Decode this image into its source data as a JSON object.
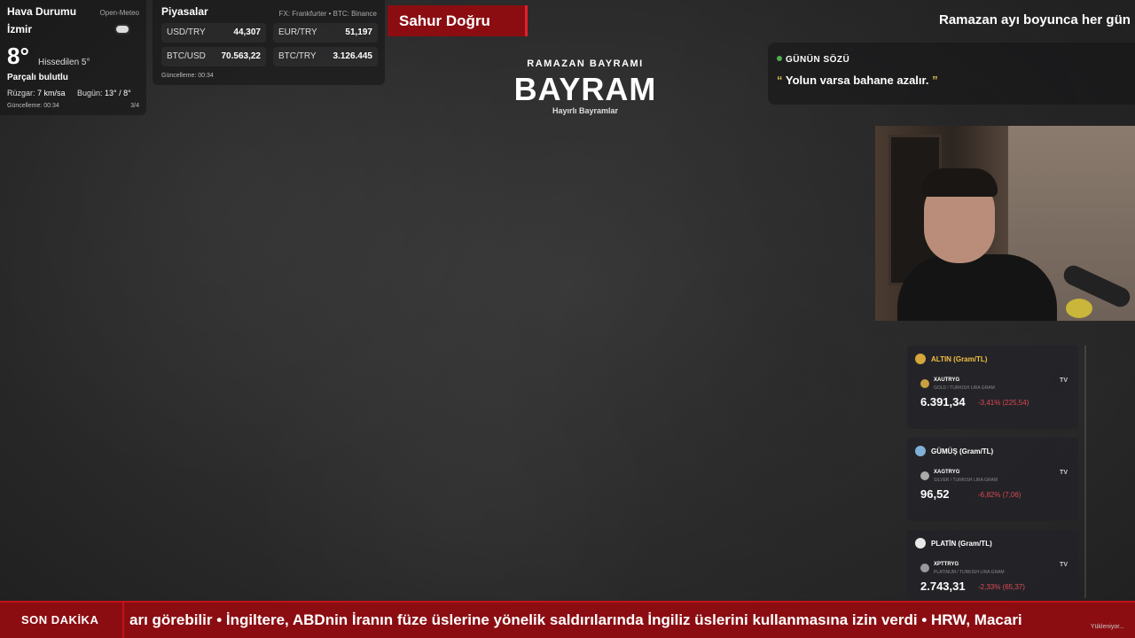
{
  "weather": {
    "title": "Hava Durumu",
    "source": "Open-Meteo",
    "city": "İzmir",
    "temp": "8°",
    "feels": "Hissedilen 5°",
    "condition": "Parçalı bulutlu",
    "wind_label": "Rüzgar:",
    "wind_value": "7 km/sa",
    "today_label": "Bugün:",
    "today_value": "13° / 8°",
    "updated": "Güncelleme: 00:34",
    "page": "3/4"
  },
  "markets": {
    "title": "Piyasalar",
    "source": "FX: Frankfurter • BTC: Binance",
    "items": [
      {
        "label": "USD/TRY",
        "value": "44,307"
      },
      {
        "label": "EUR/TRY",
        "value": "51,197"
      },
      {
        "label": "BTC/USD",
        "value": "70.563,22"
      },
      {
        "label": "BTC/TRY",
        "value": "3.126.445"
      }
    ],
    "updated": "Güncelleme: 00:34"
  },
  "banner": {
    "label": "Sahur Doğru"
  },
  "top_marquee": "Ramazan ayı boyunca her gün",
  "bayram": {
    "subtitle": "RAMAZAN BAYRAMI",
    "title": "BAYRAM",
    "note": "Hayırlı Bayramlar"
  },
  "quote": {
    "label": "GÜNÜN SÖZÜ",
    "open": "“",
    "text": " Yolun varsa bahane azalır. ",
    "close": "”"
  },
  "metals": [
    {
      "title": "ALTIN (Gram/TL)",
      "symbol": "XAUTRYG",
      "desc": "GOLD / TURKISH LIRA GRAM",
      "price": "6.391,34",
      "change": "-3,41% (225,54)",
      "color": "#d6a63a"
    },
    {
      "title": "GÜMÜŞ (Gram/TL)",
      "symbol": "XAGTRYG",
      "desc": "SILVER / TURKISH LIRA GRAM",
      "price": "96,52",
      "change": "-6,82% (7,06)",
      "color": "#7fb0d8"
    },
    {
      "title": "PLATİN (Gram/TL)",
      "symbol": "XPTTRYG",
      "desc": "PLATINUM / TURKISH LIRA GRAM",
      "price": "2.743,31",
      "change": "-2,33% (65,37)",
      "color": "#e8e8e8"
    }
  ],
  "ticker": {
    "label": "SON DAKİKA",
    "text": "arı görebilir  •  İngiltere, ABDnin İranın füze üslerine yönelik saldırılarında İngiliz üslerini kullanmasına izin verdi  •  HRW, Macari"
  },
  "loading": "Yükleniyor..."
}
